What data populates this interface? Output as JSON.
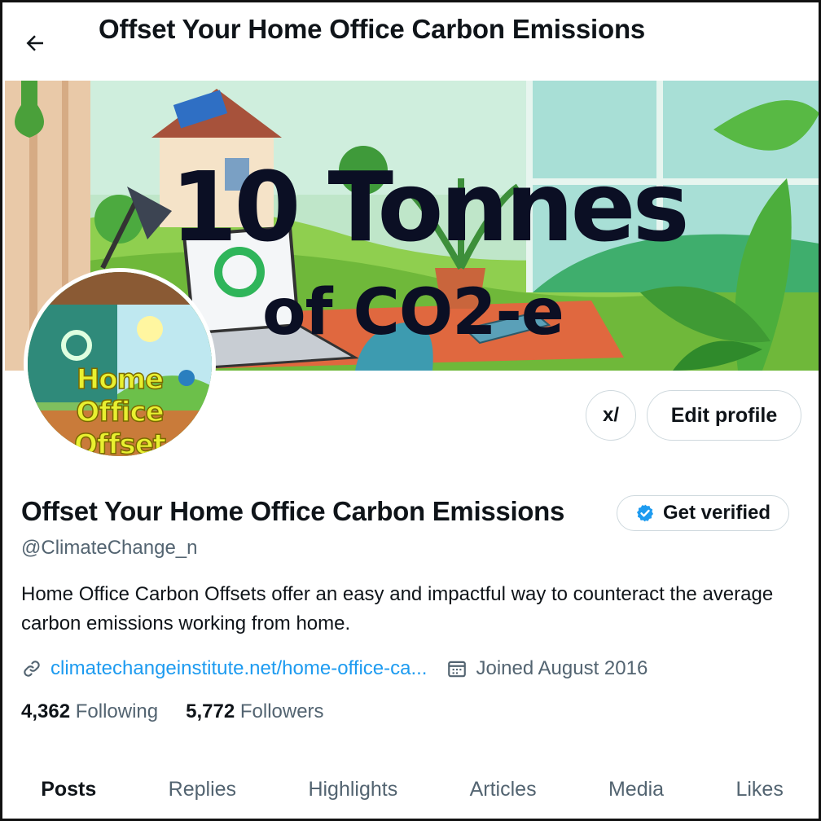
{
  "header": {
    "title": "Offset Your Home Office Carbon Emissions",
    "back_icon": "arrow-left-icon"
  },
  "banner": {
    "line1": "10 Tonnes",
    "line2": "of CO2-e"
  },
  "avatar": {
    "text_lines": [
      "Home",
      "Office",
      "Offset"
    ]
  },
  "actions": {
    "grok_label": "x/",
    "edit_label": "Edit profile"
  },
  "profile": {
    "name": "Offset Your Home Office Carbon Emissions",
    "verify_label": "Get verified",
    "handle": "@ClimateChange_n",
    "bio": "Home Office Carbon Offsets offer an easy and impactful way to counteract the average carbon emissions working from home.",
    "link": "climatechangeinstitute.net/home-office-ca...",
    "joined": "Joined August 2016",
    "following_count": "4,362",
    "following_label": "Following",
    "followers_count": "5,772",
    "followers_label": "Followers"
  },
  "tabs": [
    "Posts",
    "Replies",
    "Highlights",
    "Articles",
    "Media",
    "Likes"
  ],
  "active_tab": "Posts",
  "colors": {
    "accent": "#1d9bf0",
    "text": "#0f1419",
    "muted": "#536471",
    "border": "#cfd9de"
  }
}
